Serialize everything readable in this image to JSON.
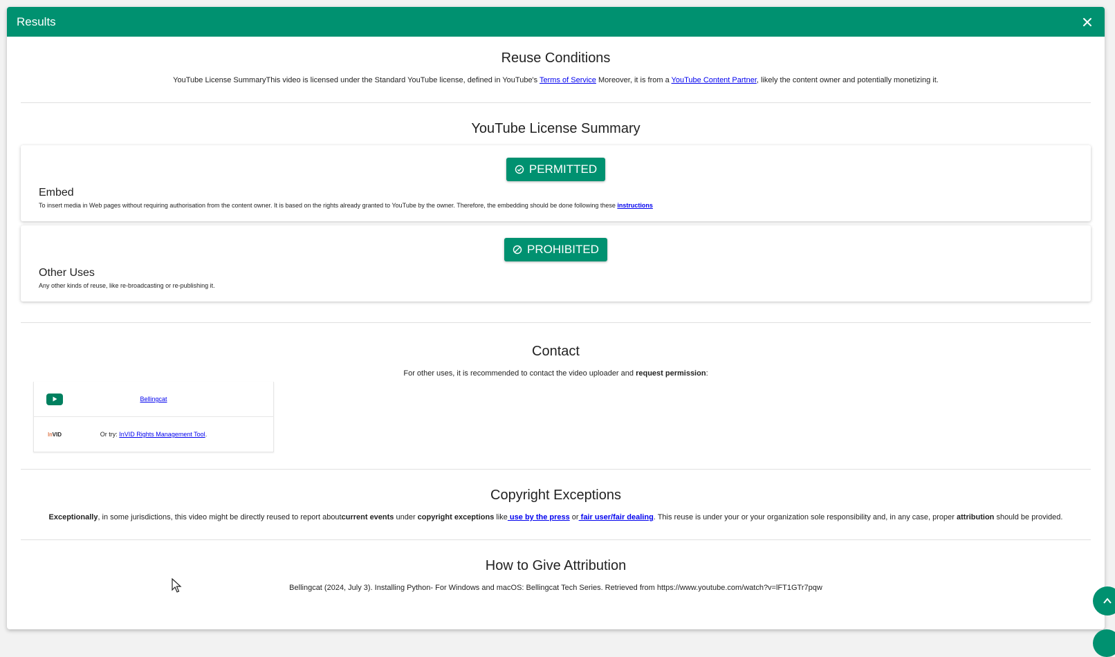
{
  "dialog": {
    "title": "Results"
  },
  "reuse": {
    "heading": "Reuse Conditions",
    "text_1": "YouTube License SummaryThis video is licensed under the Standard YouTube license, defined in YouTube's ",
    "tos_link": "Terms of Service",
    "text_2": " Moreover, it is from a ",
    "partner_link": "YouTube Content Partner",
    "text_3": ", likely the content owner and potentially monetizing it."
  },
  "license": {
    "heading": "YouTube License Summary",
    "cards": [
      {
        "status": "PERMITTED",
        "title": "Embed",
        "desc": "To insert media in Web pages without requiring authorisation from the content owner. It is based on the rights already granted to YouTube by the owner. Therefore, the embedding should be done following these ",
        "link": "instructions"
      },
      {
        "status": "PROHIBITED",
        "title": "Other Uses",
        "desc": "Any other kinds of reuse, like re-broadcasting or re-publishing it."
      }
    ]
  },
  "contact": {
    "heading": "Contact",
    "text_1": "For other uses, it is recommended to contact the video uploader and ",
    "text_bold": "request permission",
    "text_2": ":",
    "channel_link": "Bellingcat",
    "invid_prefix": "Or try: ",
    "invid_link": "InVID Rights Management Tool",
    "invid_suffix": ".",
    "invid_logo_a": "In",
    "invid_logo_b": "VID"
  },
  "copyright": {
    "heading": "Copyright Exceptions",
    "b1": "Exceptionally",
    "t1": ", in some jurisdictions, this video might be directly reused to report about",
    "b2": "current events",
    "t2": " under ",
    "b3": "copyright exceptions",
    "t3": " like",
    "link1": " use by the press",
    "t4": " or",
    "link2": " fair user/fair dealing",
    "t5": ". This reuse is under your or your organization sole responsibility and, in any case, proper ",
    "b4": "attribution",
    "t6": " should be provided."
  },
  "attribution": {
    "heading": "How to Give Attribution",
    "text": "Bellingcat (2024, July 3). Installing Python- For Windows and macOS: Bellingcat Tech Series. Retrieved from https://www.youtube.com/watch?v=lFT1GTr7pqw"
  },
  "colors": {
    "accent": "#009170"
  }
}
